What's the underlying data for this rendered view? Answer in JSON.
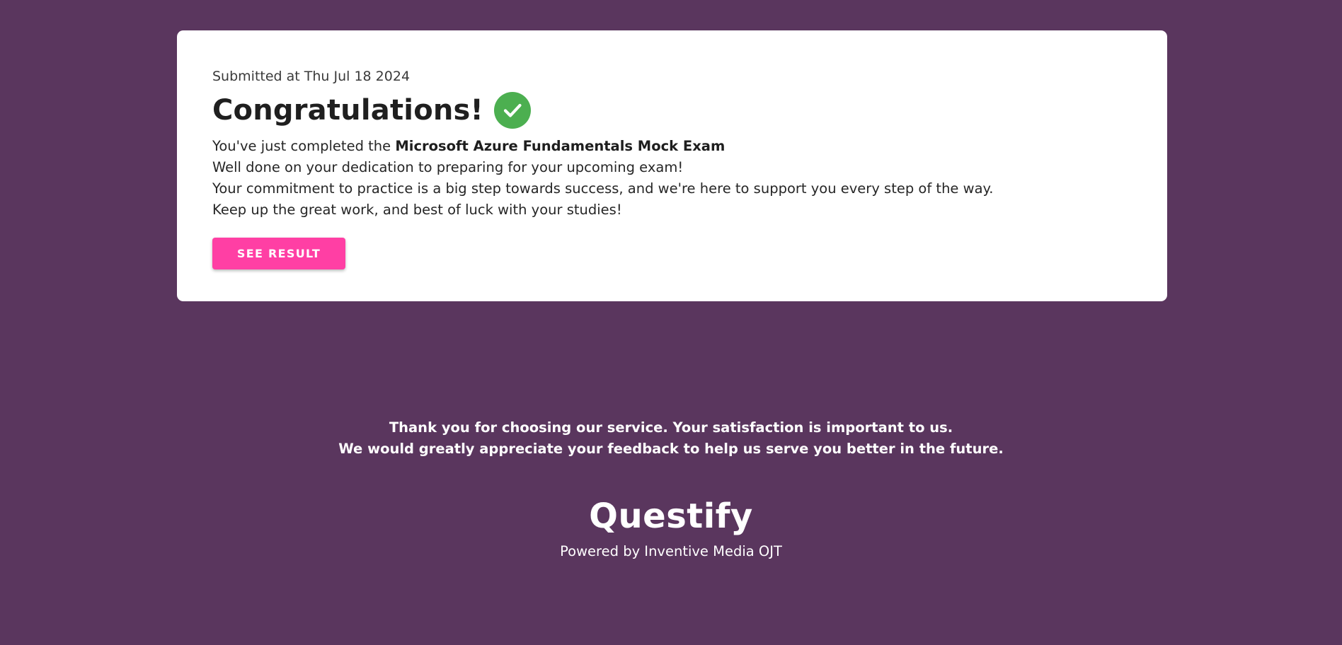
{
  "card": {
    "submitted_text": "Submitted at Thu Jul 18 2024",
    "title": "Congratulations!",
    "check_icon": "check-circle-icon",
    "check_color": "#4caf50",
    "line1_prefix": "You've just completed the ",
    "exam_name": "Microsoft Azure Fundamentals Mock Exam",
    "line2": "Well done on your dedication to preparing for your upcoming exam!",
    "line3": "Your commitment to practice is a big step towards success, and we're here to support you every step of the way.",
    "line4": "Keep up the great work, and best of luck with your studies!",
    "button_label": "SEE RESULT",
    "button_color": "#ff3fa4"
  },
  "footer": {
    "thanks_line1": "Thank you for choosing our service. Your satisfaction is important to us.",
    "thanks_line2": "We would greatly appreciate your feedback to help us serve you better in the future.",
    "brand": "Questify",
    "powered_by": "Powered by Inventive Media OJT"
  },
  "colors": {
    "background": "#5a365e",
    "card": "#ffffff"
  }
}
